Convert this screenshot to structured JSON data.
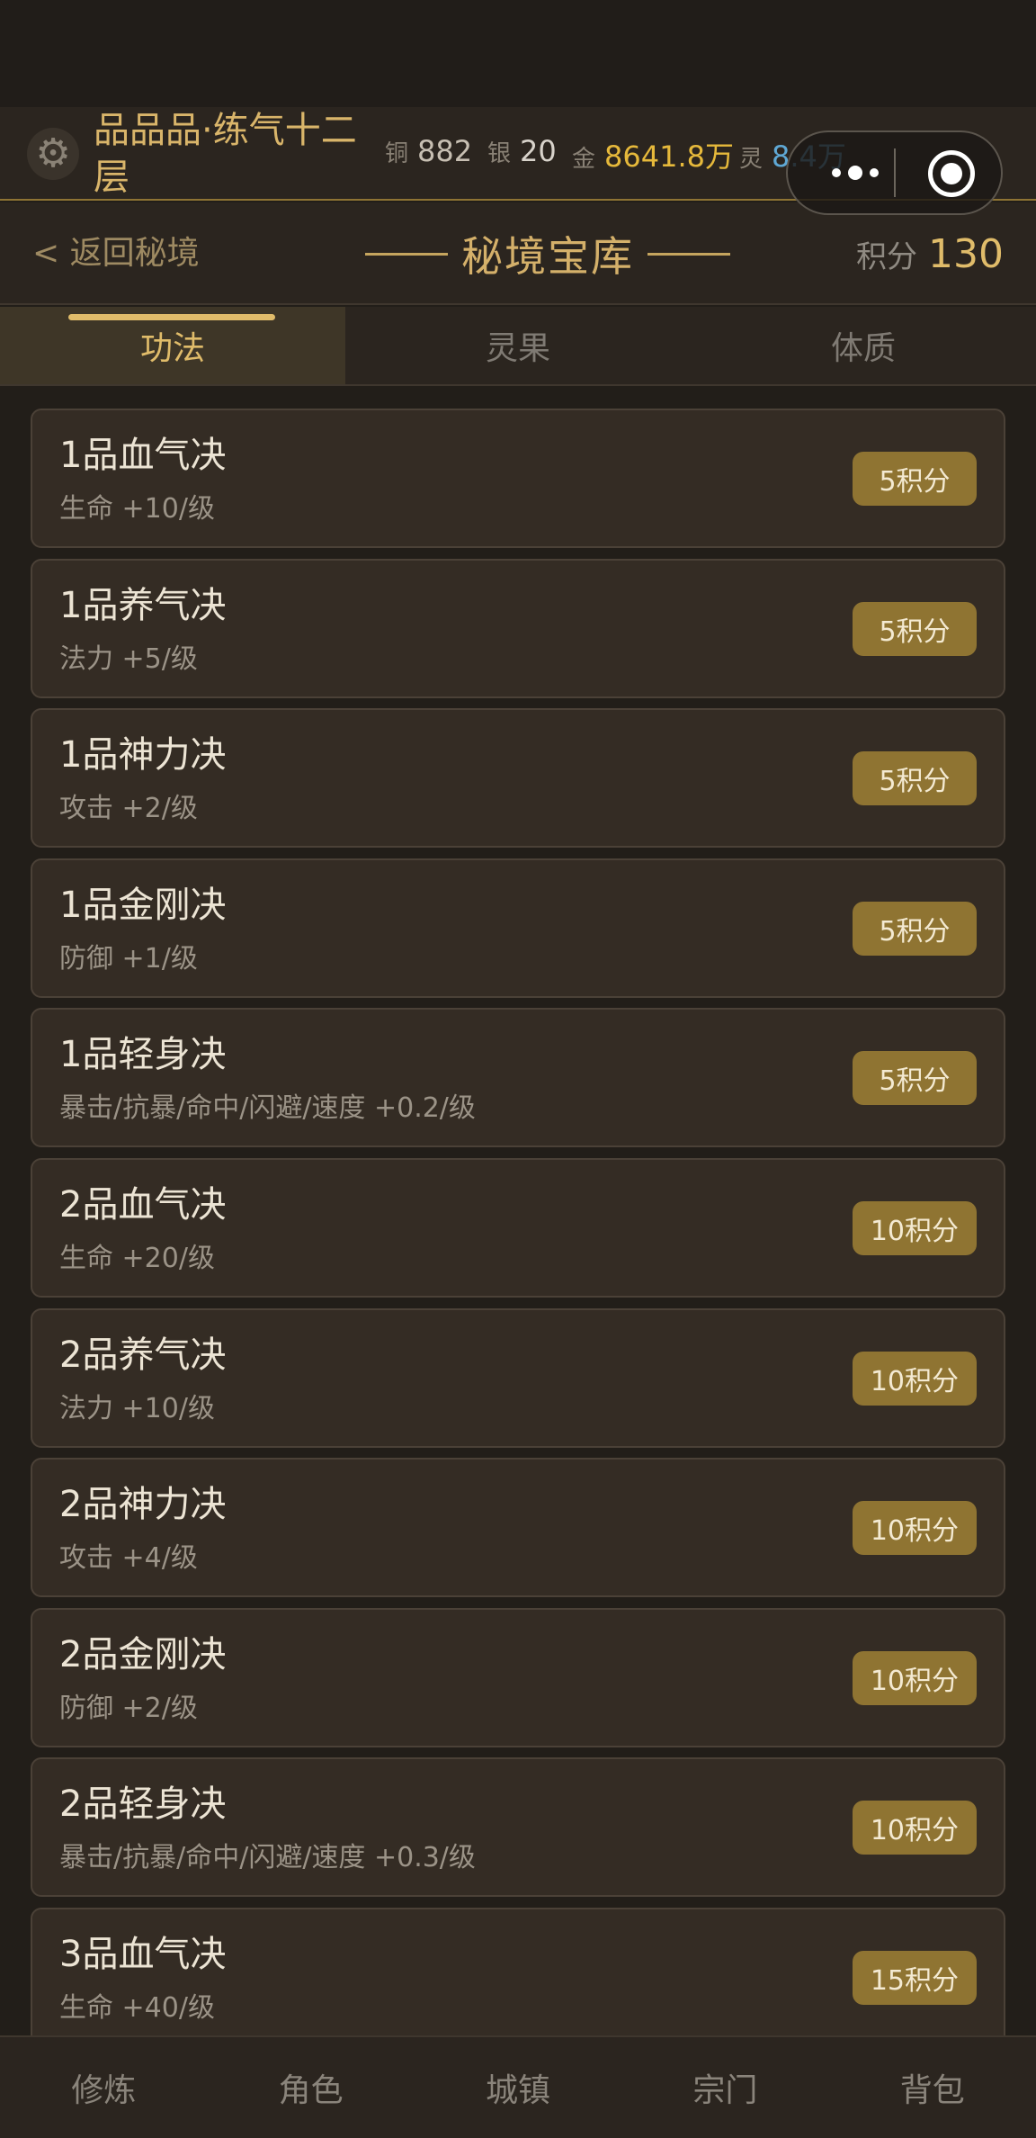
{
  "header": {
    "gear_icon": "gear-icon",
    "rank": "品品品·练气十二层",
    "currencies": [
      {
        "label": "铜",
        "value": "882",
        "color": "#c7bfb2"
      },
      {
        "label": "银",
        "value": "20",
        "color": "#d8d3cb"
      },
      {
        "label": "金",
        "value": "8641.8万",
        "color": "#e6b93b"
      },
      {
        "label": "灵",
        "value": "8.4万",
        "color": "#5fa8d4"
      }
    ]
  },
  "capsule": {
    "more_icon": "more-dots-icon",
    "close_icon": "target-close-icon"
  },
  "titlebar": {
    "back": "< 返回秘境",
    "title": "秘境宝库",
    "points_label": "积分",
    "points_value": "130"
  },
  "tabs": [
    {
      "label": "功法",
      "active": true
    },
    {
      "label": "灵果",
      "active": false
    },
    {
      "label": "体质",
      "active": false
    }
  ],
  "items": [
    {
      "name": "1品血气决",
      "desc": "生命 +10/级",
      "cost": "5积分"
    },
    {
      "name": "1品养气决",
      "desc": "法力 +5/级",
      "cost": "5积分"
    },
    {
      "name": "1品神力决",
      "desc": "攻击 +2/级",
      "cost": "5积分"
    },
    {
      "name": "1品金刚决",
      "desc": "防御 +1/级",
      "cost": "5积分"
    },
    {
      "name": "1品轻身决",
      "desc": "暴击/抗暴/命中/闪避/速度 +0.2/级",
      "cost": "5积分"
    },
    {
      "name": "2品血气决",
      "desc": "生命 +20/级",
      "cost": "10积分"
    },
    {
      "name": "2品养气决",
      "desc": "法力 +10/级",
      "cost": "10积分"
    },
    {
      "name": "2品神力决",
      "desc": "攻击 +4/级",
      "cost": "10积分"
    },
    {
      "name": "2品金刚决",
      "desc": "防御 +2/级",
      "cost": "10积分"
    },
    {
      "name": "2品轻身决",
      "desc": "暴击/抗暴/命中/闪避/速度 +0.3/级",
      "cost": "10积分"
    },
    {
      "name": "3品血气决",
      "desc": "生命 +40/级",
      "cost": "15积分"
    }
  ],
  "bottom_nav": [
    "修炼",
    "角色",
    "城镇",
    "宗门",
    "背包"
  ]
}
